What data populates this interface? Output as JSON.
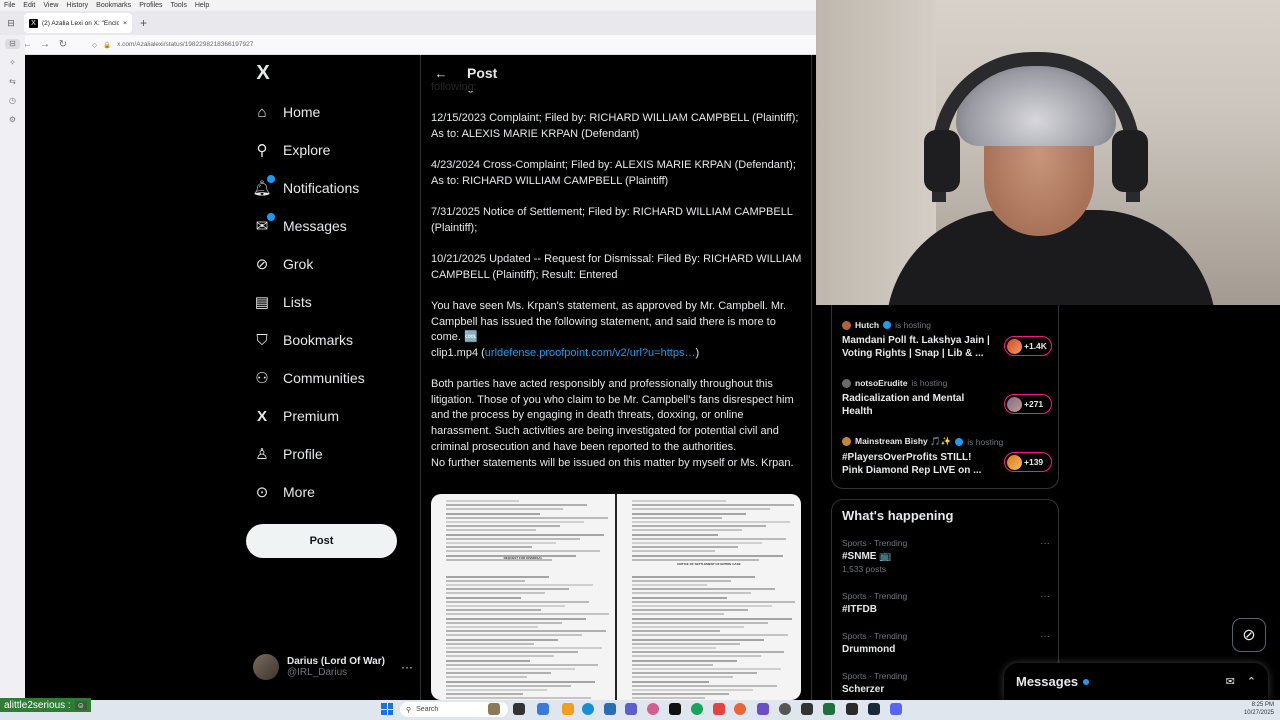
{
  "browser": {
    "menu": [
      "File",
      "Edit",
      "View",
      "History",
      "Bookmarks",
      "Profiles",
      "Tools",
      "Help"
    ],
    "tab_title": "(2) Azalia Lexi on X: \"Enclosed p",
    "url": "x.com/Azalialexi/status/1982298218366197927",
    "new_tab": "+"
  },
  "xnav": {
    "logo": "X",
    "items": [
      {
        "label": "Home",
        "icon": "home-icon"
      },
      {
        "label": "Explore",
        "icon": "search-icon"
      },
      {
        "label": "Notifications",
        "icon": "bell-icon"
      },
      {
        "label": "Messages",
        "icon": "envelope-icon"
      },
      {
        "label": "Grok",
        "icon": "grok-icon"
      },
      {
        "label": "Lists",
        "icon": "list-icon"
      },
      {
        "label": "Bookmarks",
        "icon": "bookmark-icon"
      },
      {
        "label": "Communities",
        "icon": "people-icon"
      },
      {
        "label": "Premium",
        "icon": "x-icon"
      },
      {
        "label": "Profile",
        "icon": "person-icon"
      },
      {
        "label": "More",
        "icon": "more-circle-icon"
      }
    ],
    "post_button": "Post",
    "account": {
      "display_name": "Darius (Lord Of War)",
      "handle": "@IRL_Darius"
    }
  },
  "post": {
    "header_title": "Post",
    "partial_top": "following:",
    "entries": [
      "12/15/2023  Complaint; Filed by: RICHARD WILLIAM CAMPBELL (Plaintiff); As to: ALEXIS MARIE KRPAN (Defendant)",
      "4/23/2024  Cross-Complaint; Filed by: ALEXIS MARIE KRPAN (Defendant); As to: RICHARD WILLIAM CAMPBELL (Plaintiff)",
      "7/31/2025   Notice of Settlement; Filed by: RICHARD WILLIAM CAMPBELL (Plaintiff);",
      "10/21/2025  Updated -- Request for Dismissal: Filed By: RICHARD WILLIAM CAMPBELL (Plaintiff); Result: Entered"
    ],
    "statement_intro": "You have seen Ms. Krpan's statement, as approved by Mr. Campbell.  Mr. Campbell has issued the following statement, and said there is more to come. 🆒",
    "clip_prefix": "clip1.mp4 (",
    "clip_link": "urldefense.proofpoint.com/v2/url?u=https…",
    "clip_suffix": ")",
    "body": "Both parties have acted responsibly and professionally throughout this litigation.  Those of you who claim to be Mr. Campbell's fans disrespect him and the process by engaging in death threats, doxxing, or online harassment.  Such activities are being investigated for potential civil and criminal prosecution and have been reported to the authorities.",
    "closing": "No further statements will be issued on this matter by myself or Ms. Krpan.",
    "doc_left_heading": "REQUEST FOR DISMISSAL",
    "doc_right_heading": "NOTICE OF SETTLEMENT OF ENTIRE CASE"
  },
  "spaces": [
    {
      "host": "Hutch",
      "status": "is hosting",
      "title": "Mamdani Poll ft. Lakshya Jain | Voting Rights | Snap | Lib & ...",
      "count": "+1.4K"
    },
    {
      "host": "notsoErudite",
      "status": "is hosting",
      "title": "Radicalization and Mental Health",
      "count": "+271"
    },
    {
      "host": "Mainstream Bishy 🎵✨",
      "status": "is hosting",
      "title": "#PlayersOverProfits STILL! Pink Diamond Rep LIVE on ...",
      "count": "+139"
    }
  ],
  "whats_happening": {
    "title": "What's happening",
    "trends": [
      {
        "meta": "Sports · Trending",
        "name": "#SNME 📺",
        "posts": "1,533 posts"
      },
      {
        "meta": "Sports · Trending",
        "name": "#ITFDB",
        "posts": ""
      },
      {
        "meta": "Sports · Trending",
        "name": "Drummond",
        "posts": ""
      },
      {
        "meta": "Sports · Trending",
        "name": "Scherzer",
        "posts": ""
      }
    ],
    "more": "···"
  },
  "messages_drawer": {
    "title": "Messages"
  },
  "stream": {
    "chat_user": "alittle2serious :"
  },
  "taskbar": {
    "search_placeholder": "Search",
    "time": "8:25 PM",
    "date": "10/27/2025"
  }
}
